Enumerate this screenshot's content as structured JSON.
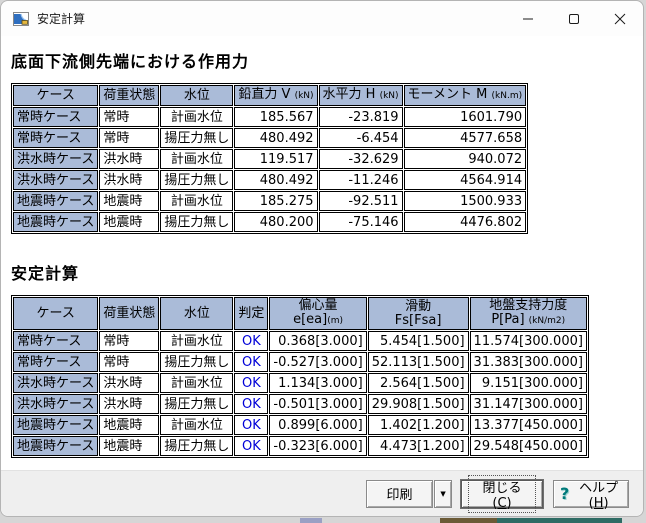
{
  "window": {
    "title": "安定計算",
    "icon_name": "weir-icon"
  },
  "section1": {
    "heading": "底面下流側先端における作用力",
    "table": {
      "columns": [
        {
          "label": "ケース",
          "unit": ""
        },
        {
          "label": "荷重状態",
          "unit": ""
        },
        {
          "label": "水位",
          "unit": ""
        },
        {
          "label": "鉛直力 V ",
          "unit": "(kN)"
        },
        {
          "label": "水平力 H ",
          "unit": "(kN)"
        },
        {
          "label": "モーメント M ",
          "unit": "(kN.m)"
        }
      ],
      "rows": [
        {
          "case": "常時ケース",
          "load": "常時",
          "level": "計画水位",
          "v": "185.567",
          "h": "-23.819",
          "m": "1601.790"
        },
        {
          "case": "常時ケース",
          "load": "常時",
          "level": "揚圧力無し",
          "v": "480.492",
          "h": "-6.454",
          "m": "4577.658"
        },
        {
          "case": "洪水時ケース",
          "load": "洪水時",
          "level": "計画水位",
          "v": "119.517",
          "h": "-32.629",
          "m": "940.072"
        },
        {
          "case": "洪水時ケース",
          "load": "洪水時",
          "level": "揚圧力無し",
          "v": "480.492",
          "h": "-11.246",
          "m": "4564.914"
        },
        {
          "case": "地震時ケース",
          "load": "地震時",
          "level": "計画水位",
          "v": "185.275",
          "h": "-92.511",
          "m": "1500.933"
        },
        {
          "case": "地震時ケース",
          "load": "地震時",
          "level": "揚圧力無し",
          "v": "480.200",
          "h": "-75.146",
          "m": "4476.802"
        }
      ]
    }
  },
  "section2": {
    "heading": "安定計算",
    "table": {
      "columns": [
        {
          "line1": "ケース",
          "line2": "",
          "unit": ""
        },
        {
          "line1": "荷重状態",
          "line2": "",
          "unit": ""
        },
        {
          "line1": "水位",
          "line2": "",
          "unit": ""
        },
        {
          "line1": "判定",
          "line2": "",
          "unit": ""
        },
        {
          "line1": "偏心量",
          "line2": "e[ea]",
          "unit": "(m)"
        },
        {
          "line1": "滑動",
          "line2": "Fs[Fsa]",
          "unit": ""
        },
        {
          "line1": "地盤支持力度",
          "line2": "P[Pa] ",
          "unit": "(kN/m2)"
        }
      ],
      "rows": [
        {
          "case": "常時ケース",
          "load": "常時",
          "level": "計画水位",
          "judge": "OK",
          "e": "0.368[3.000]",
          "fs": "5.454[1.500]",
          "p": "11.574[300.000]"
        },
        {
          "case": "常時ケース",
          "load": "常時",
          "level": "揚圧力無し",
          "judge": "OK",
          "e": "-0.527[3.000]",
          "fs": "52.113[1.500]",
          "p": "31.383[300.000]"
        },
        {
          "case": "洪水時ケース",
          "load": "洪水時",
          "level": "計画水位",
          "judge": "OK",
          "e": "1.134[3.000]",
          "fs": "2.564[1.500]",
          "p": "9.151[300.000]"
        },
        {
          "case": "洪水時ケース",
          "load": "洪水時",
          "level": "揚圧力無し",
          "judge": "OK",
          "e": "-0.501[3.000]",
          "fs": "29.908[1.500]",
          "p": "31.147[300.000]"
        },
        {
          "case": "地震時ケース",
          "load": "地震時",
          "level": "計画水位",
          "judge": "OK",
          "e": "0.899[6.000]",
          "fs": "1.402[1.200]",
          "p": "13.377[450.000]"
        },
        {
          "case": "地震時ケース",
          "load": "地震時",
          "level": "揚圧力無し",
          "judge": "OK",
          "e": "-0.323[6.000]",
          "fs": "4.473[1.200]",
          "p": "29.548[450.000]"
        }
      ]
    }
  },
  "footer": {
    "print_label": "印刷",
    "print_arrow": "▼",
    "close_pre": "閉じる(",
    "close_mnemonic": "C",
    "close_post": ")",
    "help_icon": "?",
    "help_pre": "ヘルプ(",
    "help_mnemonic": "H",
    "help_post": ")"
  },
  "colors": {
    "table_header_bg": "#aabbd8",
    "judge_ok_blue": "#0000d8",
    "help_question_teal": "#007a7a",
    "behind_strip_olive": "#6b5a36",
    "behind_strip_teal": "#2e6b64"
  }
}
